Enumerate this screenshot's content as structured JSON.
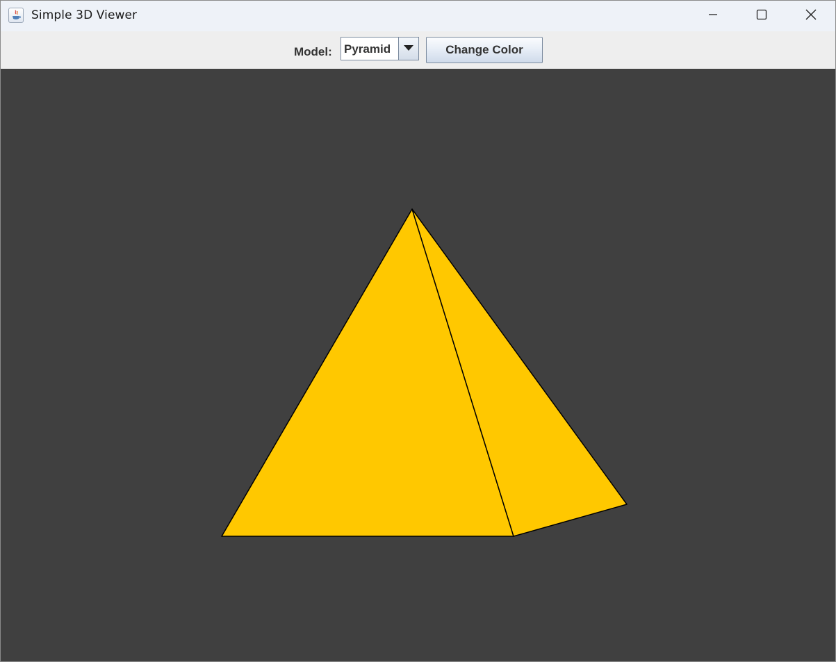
{
  "window": {
    "title": "Simple 3D Viewer",
    "icon": "java-app-icon"
  },
  "title_controls": {
    "minimize_icon": "minimize-icon",
    "maximize_icon": "maximize-icon",
    "close_icon": "close-icon"
  },
  "toolbar": {
    "model_label": "Model:",
    "model_selected": "Pyramid",
    "change_color_label": "Change Color"
  },
  "viewport": {
    "background_color": "#404040",
    "model": "Pyramid",
    "fill_color": "#ffc800",
    "edge_color": "#000000"
  }
}
